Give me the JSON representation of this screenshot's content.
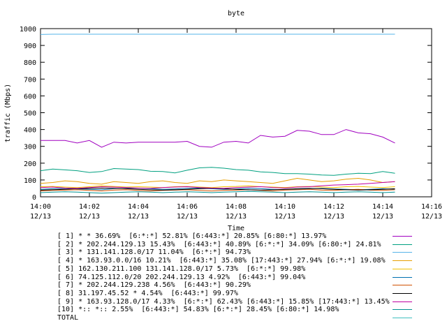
{
  "chart_data": {
    "type": "line",
    "title": "byte",
    "xlabel": "Time",
    "ylabel": "traffic (Mbps)",
    "ylim": [
      0,
      1000
    ],
    "y_ticks": [
      "0",
      "100",
      "200",
      "300",
      "400",
      "500",
      "600",
      "700",
      "800",
      "900",
      "1000"
    ],
    "x_range": [
      "14:00",
      "14:16"
    ],
    "x_ticks": [
      {
        "time": "14:00",
        "date": "12/13"
      },
      {
        "time": "14:02",
        "date": "12/13"
      },
      {
        "time": "14:04",
        "date": "12/13"
      },
      {
        "time": "14:06",
        "date": "12/13"
      },
      {
        "time": "14:08",
        "date": "12/13"
      },
      {
        "time": "14:10",
        "date": "12/13"
      },
      {
        "time": "14:12",
        "date": "12/13"
      },
      {
        "time": "14:14",
        "date": "12/13"
      },
      {
        "time": "14:16",
        "date": "12/13"
      }
    ],
    "grid": false,
    "legend_position": "bottom",
    "x": [
      "14:00:00",
      "14:00:30",
      "14:01:00",
      "14:01:30",
      "14:02:00",
      "14:02:30",
      "14:03:00",
      "14:03:30",
      "14:04:00",
      "14:04:30",
      "14:05:00",
      "14:05:30",
      "14:06:00",
      "14:06:30",
      "14:07:00",
      "14:07:30",
      "14:08:00",
      "14:08:30",
      "14:09:00",
      "14:09:30",
      "14:10:00",
      "14:10:30",
      "14:11:00",
      "14:11:30",
      "14:12:00",
      "14:12:30",
      "14:13:00",
      "14:13:30",
      "14:14:00",
      "14:14:30"
    ],
    "series": [
      {
        "name": "[ 1] * * 36.69%  [6:*:*] 52.81% [6:443:*] 20.85% [6:80:*] 13.97%",
        "color": "#a000c0",
        "values": [
          335,
          335,
          335,
          320,
          335,
          295,
          325,
          320,
          325,
          325,
          325,
          325,
          330,
          300,
          295,
          325,
          330,
          320,
          365,
          355,
          360,
          395,
          390,
          370,
          370,
          400,
          380,
          375,
          355,
          320
        ]
      },
      {
        "name": "[ 2] * 202.244.129.13 15.43%  [6:443:*] 40.89% [6:*:*] 34.09% [6:80:*] 24.81%",
        "color": "#00a080",
        "values": [
          155,
          165,
          160,
          155,
          145,
          150,
          168,
          165,
          162,
          152,
          150,
          142,
          158,
          172,
          175,
          170,
          162,
          158,
          148,
          145,
          138,
          138,
          135,
          130,
          128,
          135,
          140,
          138,
          150,
          140
        ]
      },
      {
        "name": "[ 3] * 131.141.128.0/17 11.04%  [6:*:*] 94.73%",
        "color": "#56b4e9",
        "values": [
          965,
          967,
          967,
          967,
          967,
          967,
          967,
          967,
          967,
          967,
          967,
          967,
          967,
          967,
          967,
          967,
          967,
          967,
          967,
          967,
          967,
          967,
          967,
          967,
          967,
          967,
          967,
          967,
          967,
          967
        ]
      },
      {
        "name": "[ 4] * 163.93.0.0/16 10.21%  [6:443:*] 35.08% [17:443:*] 27.94% [6:*:*] 19.08%",
        "color": "#e69f00",
        "values": [
          80,
          85,
          95,
          90,
          80,
          75,
          90,
          85,
          80,
          90,
          95,
          85,
          80,
          95,
          90,
          100,
          95,
          90,
          85,
          80,
          95,
          110,
          100,
          90,
          95,
          105,
          110,
          100,
          85,
          90
        ]
      },
      {
        "name": "[ 5] 162.130.211.100 131.141.128.0/17 5.73%  [6:*:*] 99.98%",
        "color": "#f0c000",
        "values": [
          60,
          62,
          58,
          55,
          60,
          65,
          62,
          58,
          60,
          58,
          55,
          60,
          62,
          58,
          55,
          60,
          62,
          65,
          60,
          58,
          55,
          60,
          62,
          58,
          55,
          60,
          62,
          58,
          55,
          60
        ]
      },
      {
        "name": "[ 6] 74.125.112.0/20 202.244.129.13 4.92%  [6:443:*] 99.04%",
        "color": "#0070b0",
        "values": [
          45,
          48,
          50,
          47,
          45,
          42,
          48,
          50,
          52,
          48,
          45,
          47,
          50,
          52,
          48,
          45,
          47,
          50,
          48,
          45,
          42,
          45,
          48,
          50,
          47,
          45,
          42,
          45,
          48,
          45
        ]
      },
      {
        "name": "[ 7] * 202.244.129.238 4.56%  [6:443:*] 90.29%",
        "color": "#d05000",
        "values": [
          35,
          38,
          40,
          42,
          38,
          35,
          40,
          42,
          38,
          35,
          38,
          40,
          42,
          38,
          35,
          38,
          40,
          42,
          38,
          35,
          40,
          42,
          45,
          40,
          38,
          42,
          45,
          40,
          38,
          42
        ]
      },
      {
        "name": "[ 8] 31.197.45.52 * 4.54%  [6:443:*] 99.97%",
        "color": "#000000",
        "values": [
          40,
          42,
          45,
          48,
          50,
          52,
          50,
          48,
          45,
          42,
          40,
          42,
          45,
          48,
          50,
          48,
          45,
          42,
          40,
          42,
          45,
          48,
          50,
          48,
          45,
          42,
          40,
          42,
          45,
          48
        ]
      },
      {
        "name": "[ 9] * 163.93.128.0/17 4.33%  [6:*:*] 62.43% [6:443:*] 15.85% [17:443:*] 13.45%",
        "color": "#c000a0",
        "values": [
          55,
          58,
          52,
          50,
          55,
          60,
          58,
          55,
          52,
          50,
          55,
          58,
          60,
          55,
          52,
          50,
          55,
          58,
          60,
          55,
          52,
          58,
          60,
          65,
          70,
          72,
          75,
          80,
          85,
          90
        ]
      },
      {
        "name": "[10] *:: *:: 2.55%  [6:443:*] 54.83% [6:*:*] 28.45% [6:80:*] 14.98%",
        "color": "#009090",
        "values": [
          25,
          28,
          30,
          28,
          25,
          22,
          25,
          28,
          30,
          28,
          25,
          28,
          30,
          28,
          25,
          28,
          30,
          32,
          30,
          28,
          25,
          28,
          30,
          28,
          25,
          28,
          30,
          28,
          25,
          28
        ]
      },
      {
        "name": "TOTAL",
        "color": "#40c0c0",
        "values": []
      }
    ]
  }
}
